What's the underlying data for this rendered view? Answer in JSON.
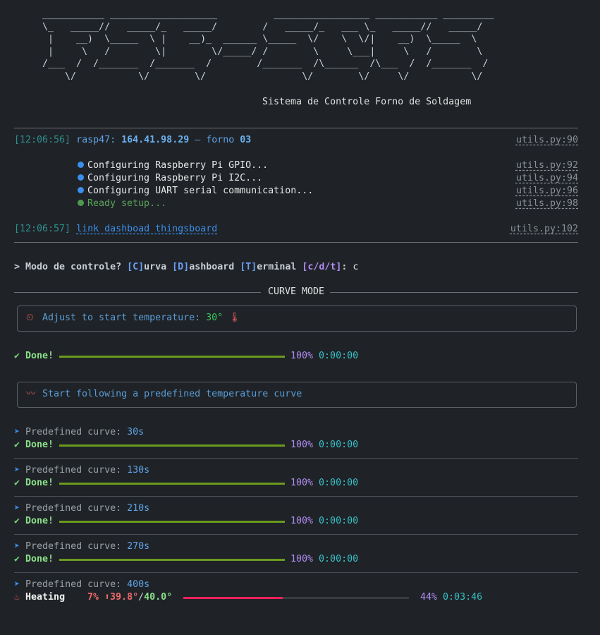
{
  "banner": {
    "ascii_art": " ___________ ___________________          _________________ ___________ _________\n \\_   _____//   _____/_   _____/        /   _____/_   ___ \\_   _____//   _____/\n  |    __)  \\_____  \\ |    __)_  ______ \\_____  \\/    \\  \\/|    __)  \\_____  \\\n  |     \\   /        \\|        \\/_____/ /        \\     \\___|     \\   /        \\\n /___  /  /_______  /_______  /        /_______  /\\______  /\\___  /  /_______  /\n     \\/           \\/        \\/                 \\/        \\/     \\/           \\/",
    "subtitle": "Sistema de Controle Forno de Soldagem"
  },
  "log": {
    "line1": {
      "timestamp": "[12:06:56]",
      "host": "rasp47:",
      "ip": "164.41.98.29",
      "dash": " – forno ",
      "forno": "03",
      "ref": "utils.py:90"
    },
    "setup": [
      {
        "text": "Configuring Raspberry Pi GPIO...",
        "ref": "utils.py:92",
        "status": "info"
      },
      {
        "text": "Configuring Raspberry Pi I2C...",
        "ref": "utils.py:94",
        "status": "info"
      },
      {
        "text": "Configuring UART serial communication...",
        "ref": "utils.py:96",
        "status": "info"
      },
      {
        "text": "Ready setup...",
        "ref": "utils.py:98",
        "status": "ok"
      }
    ],
    "line2": {
      "timestamp": "[12:06:57]",
      "link": "link dashboad thingsboard",
      "ref": "utils.py:102"
    }
  },
  "prompt": {
    "prefix": "> Modo de controle? ",
    "opt_c_key": "[C]",
    "opt_c": "urva ",
    "opt_d_key": "[D]",
    "opt_d": "ashboard ",
    "opt_t_key": "[T]",
    "opt_t": "erminal ",
    "choices": "[c/d/t]",
    "colon": ": ",
    "answer": "c"
  },
  "mode_title": "CURVE MODE",
  "adjust_box": {
    "icon": "stopwatch-icon",
    "text": "Adjust to start temperature: ",
    "value": "30°",
    "icon2": "thermometer-icon"
  },
  "adjust_progress": {
    "label": "Done!",
    "percent": 100,
    "percent_text": "100%",
    "time": "0:00:00"
  },
  "curve_box": {
    "icon": "wave-icon",
    "text": "Start following a predefined temperature curve"
  },
  "curves": [
    {
      "label": "Predefined curve: ",
      "value": "30s",
      "status": "Done!",
      "percent": 100,
      "percent_text": "100%",
      "time": "0:00:00"
    },
    {
      "label": "Predefined curve: ",
      "value": "130s",
      "status": "Done!",
      "percent": 100,
      "percent_text": "100%",
      "time": "0:00:00"
    },
    {
      "label": "Predefined curve: ",
      "value": "210s",
      "status": "Done!",
      "percent": 100,
      "percent_text": "100%",
      "time": "0:00:00"
    },
    {
      "label": "Predefined curve: ",
      "value": "270s",
      "status": "Done!",
      "percent": 100,
      "percent_text": "100%",
      "time": "0:00:00"
    }
  ],
  "current": {
    "label": "Predefined curve: ",
    "value": "400s",
    "status": "Heating",
    "power": "7%",
    "current_temp": "39.8°",
    "slash": "/",
    "target_temp": "40.0°",
    "percent": 44,
    "percent_text": "44%",
    "time": "0:03:46"
  },
  "colors": {
    "background": "#1f2327",
    "done_bar": "#6a9a1f",
    "heating_bar": "#ff1f5a",
    "bar_track": "#3a3d40"
  }
}
